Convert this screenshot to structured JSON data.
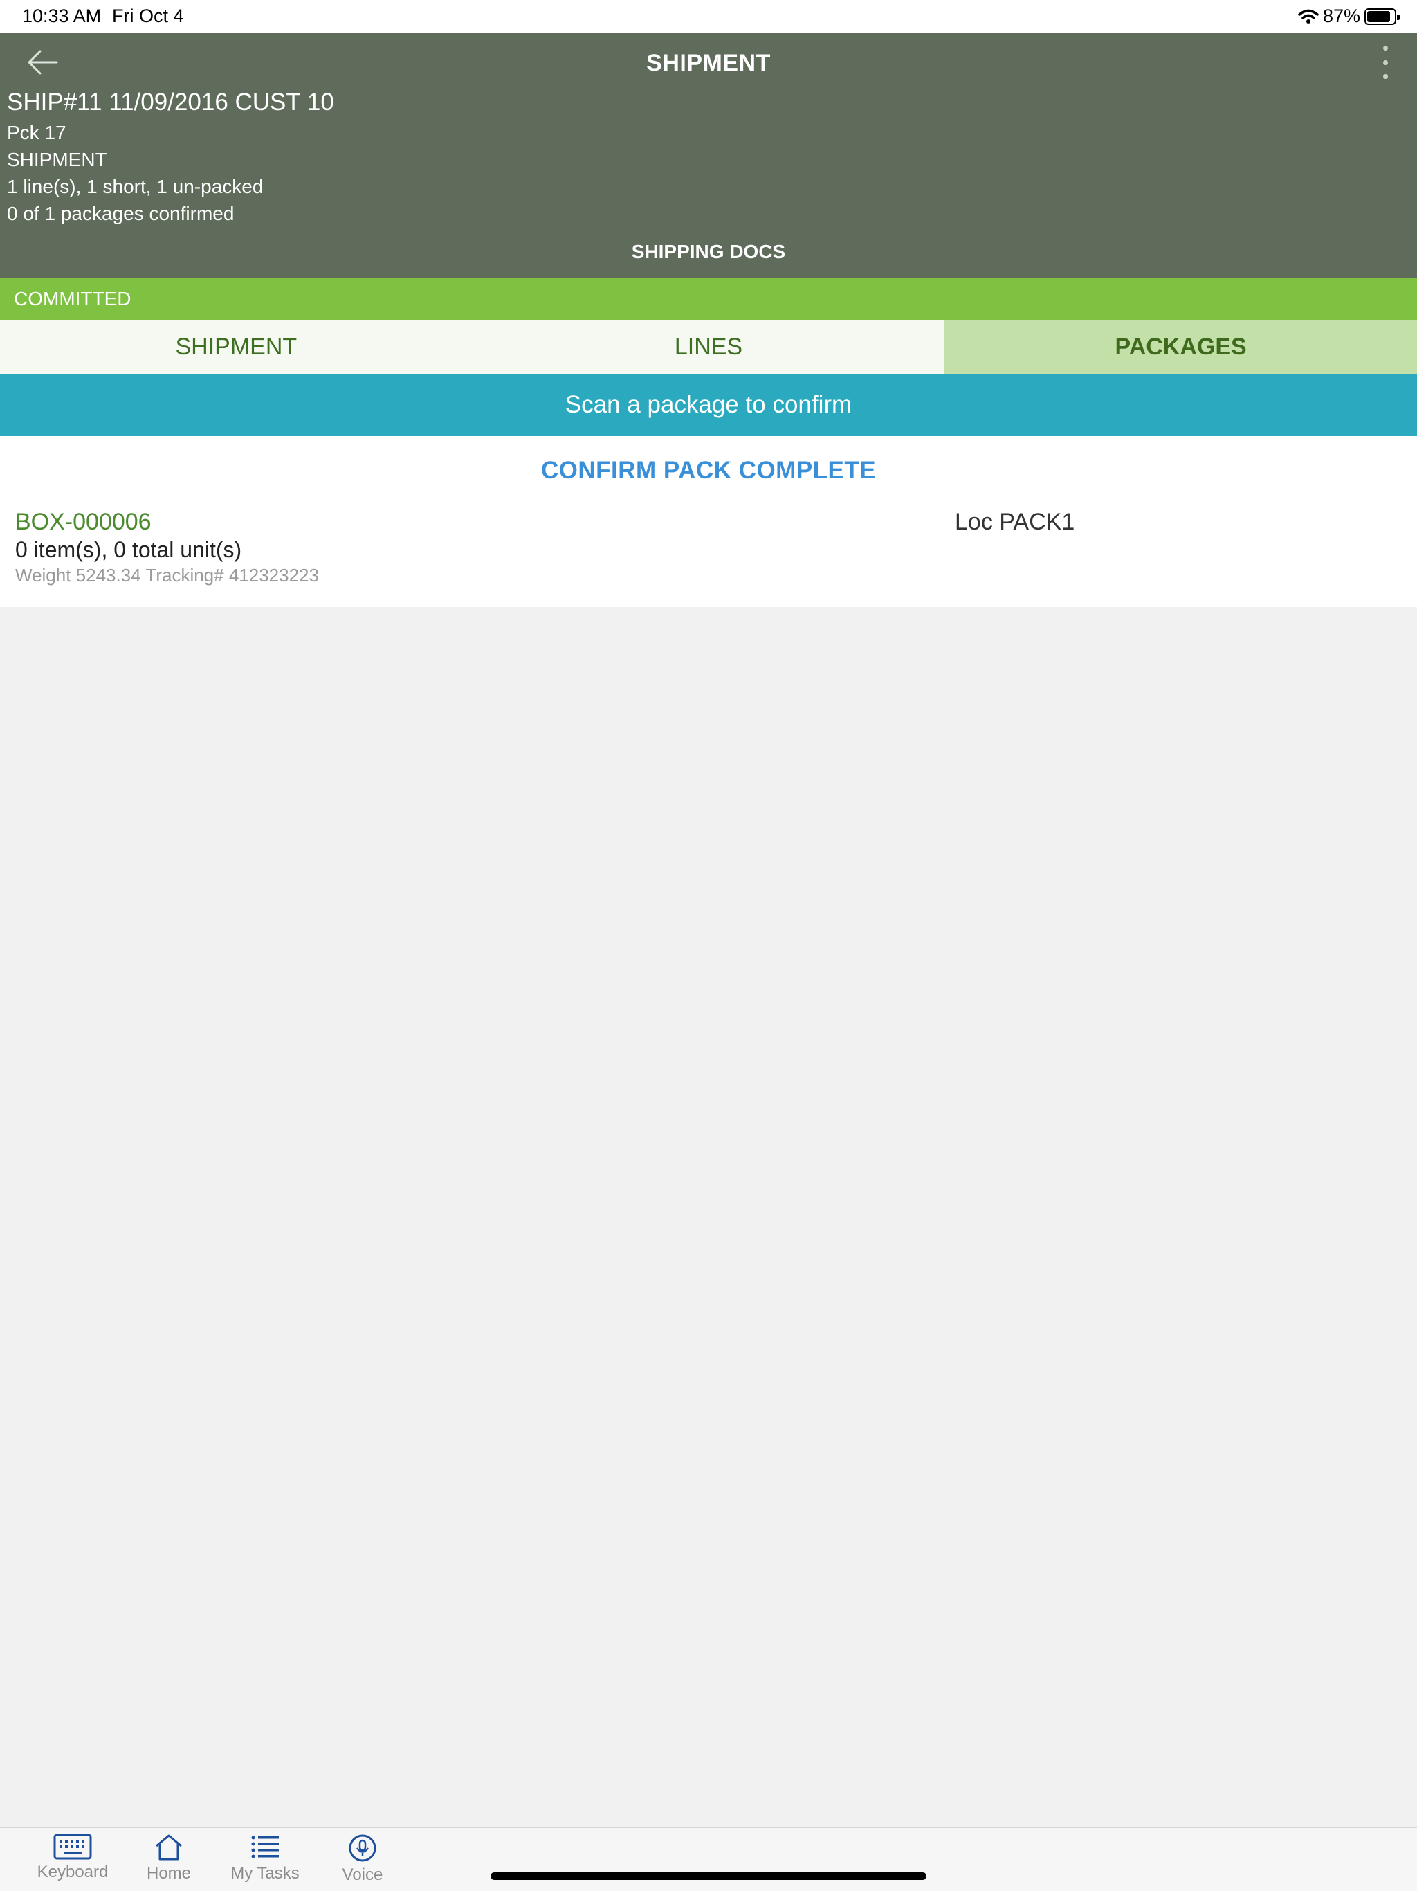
{
  "status_bar": {
    "time": "10:33 AM",
    "date": "Fri Oct 4",
    "battery": "87%",
    "battery_level": 0.87,
    "icons": [
      "wifi-icon",
      "battery-icon"
    ]
  },
  "header": {
    "title": "SHIPMENT",
    "back_icon": "arrow-left-icon",
    "menu_icon": "more-vertical-icon",
    "info": {
      "line1": "SHIP#11 11/09/2016 CUST 10",
      "line2": "Pck 17",
      "line3": "SHIPMENT",
      "line4": "1 line(s), 1 short, 1 un-packed",
      "line5": "0 of 1 packages confirmed"
    },
    "shipping_docs": "SHIPPING DOCS"
  },
  "status_banner": {
    "label": "COMMITTED",
    "color": "#7fc241"
  },
  "tabs": [
    {
      "label": "SHIPMENT",
      "active": false
    },
    {
      "label": "LINES",
      "active": false
    },
    {
      "label": "PACKAGES",
      "active": true
    }
  ],
  "scan_banner": {
    "text": "Scan a package to confirm",
    "color": "#2ba9bf"
  },
  "actions": {
    "confirm_label": "CONFIRM PACK COMPLETE"
  },
  "packages": [
    {
      "name": "BOX-000006",
      "location": "Loc PACK1",
      "counts": "0 item(s), 0 total unit(s)",
      "meta": "Weight 5243.34  Tracking# 412323223"
    }
  ],
  "toolbar": {
    "items": [
      {
        "label": "Keyboard",
        "icon": "keyboard-icon"
      },
      {
        "label": "Home",
        "icon": "home-icon"
      },
      {
        "label": "My Tasks",
        "icon": "list-icon"
      },
      {
        "label": "Voice",
        "icon": "microphone-icon"
      }
    ]
  },
  "colors": {
    "header_bg": "#5f6b5b",
    "accent_green": "#4b8a2e",
    "link_blue": "#3a8fd9"
  }
}
